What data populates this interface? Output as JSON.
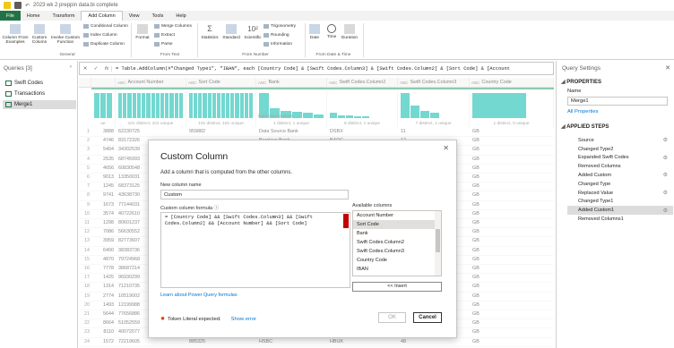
{
  "app": {
    "title": "2023 wk 2 preppin data.bi complete"
  },
  "tabs": [
    "File",
    "Home",
    "Transform",
    "Add Column",
    "View",
    "Tools",
    "Help"
  ],
  "ribbon": {
    "general": {
      "col_from_examples": "Column From Examples",
      "custom_column": "Custom Column",
      "invoke_custom_function": "Invoke Custom Function",
      "conditional_column": "Conditional Column",
      "index_column": "Index Column",
      "duplicate_column": "Duplicate Column",
      "group": "General"
    },
    "from_text": {
      "format": "Format",
      "merge_columns": "Merge Columns",
      "extract": "Extract",
      "parse": "Parse",
      "group": "From Text"
    },
    "from_number": {
      "statistics": "Statistics",
      "standard": "Standard",
      "scientific": "Scientific",
      "trigonometry": "Trigonometry",
      "rounding": "Rounding",
      "information": "Information",
      "group": "From Number"
    },
    "from_date_time": {
      "date": "Date",
      "time": "Time",
      "duration": "Duration",
      "group": "From Date & Time"
    }
  },
  "queries": {
    "header": "Queries [3]",
    "items": [
      "Swift Codes",
      "Transactions",
      "Merge1"
    ]
  },
  "formula": "= Table.AddColumn(#\"Changed Type1\", \"IBAN\", each [Country Code] & [Swift Codes.Column3] & [Swift Codes.Column2] & [Sort Code] & [Account",
  "grid": {
    "columns": [
      {
        "name": "",
        "type": ""
      },
      {
        "name": "Account Number",
        "type": "ABC"
      },
      {
        "name": "Sort Code",
        "type": "ABC"
      },
      {
        "name": "Bank",
        "type": "ABC"
      },
      {
        "name": "Swift Codes.Column2",
        "type": "ABC"
      },
      {
        "name": "Swift Codes.Column3",
        "type": "ABC"
      },
      {
        "name": "Country Code",
        "type": "ABC"
      }
    ],
    "profile": [
      "ue",
      "101 distinct, 101 unique",
      "101 distinct, 101 unique",
      "1 distinct, 1 unique",
      "8 distinct, 1 unique",
      "7 distinct, 1 unique",
      "1 distinct, 0 unique"
    ],
    "profile_label": "Data Source Bank",
    "rows": [
      [
        "1",
        "3888",
        "62230725",
        "959882",
        "Data Source Bank",
        "DSBX",
        "11",
        "GB"
      ],
      [
        "2",
        "4746",
        "83172326",
        "",
        "Barclays Bank",
        "BARC",
        "12",
        "GB"
      ],
      [
        "3",
        "5404",
        "34302539",
        "",
        "",
        "",
        "",
        "GB"
      ],
      [
        "4",
        "2535",
        "68745993",
        "",
        "",
        "",
        "",
        "GB"
      ],
      [
        "5",
        "4656",
        "60830548",
        "",
        "",
        "",
        "",
        "GB"
      ],
      [
        "6",
        "9013",
        "13350031",
        "",
        "",
        "",
        "",
        "GB"
      ],
      [
        "7",
        "1245",
        "68373125",
        "",
        "",
        "",
        "",
        "GB"
      ],
      [
        "8",
        "9741",
        "43638730",
        "",
        "",
        "",
        "",
        "GB"
      ],
      [
        "9",
        "1673",
        "77144031",
        "",
        "",
        "",
        "",
        "GB"
      ],
      [
        "10",
        "3574",
        "40722610",
        "",
        "",
        "",
        "",
        "GB"
      ],
      [
        "11",
        "1298",
        "80601237",
        "",
        "",
        "",
        "",
        "GB"
      ],
      [
        "12",
        "7086",
        "56630552",
        "",
        "",
        "",
        "",
        "GB"
      ],
      [
        "13",
        "3959",
        "82773607",
        "",
        "",
        "",
        "",
        "GB"
      ],
      [
        "14",
        "6400",
        "38383736",
        "",
        "",
        "",
        "",
        "GB"
      ],
      [
        "15",
        "4870",
        "79724968",
        "",
        "",
        "",
        "",
        "GB"
      ],
      [
        "16",
        "7778",
        "38687214",
        "",
        "",
        "",
        "",
        "GB"
      ],
      [
        "17",
        "1425",
        "96930299",
        "",
        "",
        "",
        "",
        "GB"
      ],
      [
        "18",
        "1314",
        "71210735",
        "",
        "",
        "",
        "",
        "GB"
      ],
      [
        "19",
        "2774",
        "10519002",
        "",
        "",
        "",
        "",
        "GB"
      ],
      [
        "20",
        "1493",
        "12199988",
        "",
        "",
        "",
        "",
        "GB"
      ],
      [
        "21",
        "5644",
        "77656886",
        "",
        "",
        "",
        "",
        "GB"
      ],
      [
        "22",
        "8664",
        "51052559",
        "",
        "",
        "",
        "",
        "GB"
      ],
      [
        "23",
        "8110",
        "40072077",
        "",
        "",
        "",
        "",
        "GB"
      ],
      [
        "24",
        "1572",
        "72219605",
        "885325",
        "HSBC",
        "HBUK",
        "48",
        "GB"
      ]
    ]
  },
  "dialog": {
    "title": "Custom Column",
    "description": "Add a column that is computed from the other columns.",
    "name_label": "New column name",
    "name_value": "Custom",
    "formula_label": "Custom column formula",
    "formula_value": "= [Country Code] && [Swift Codes.Column3] && [Swift Codes.Column2] && [Account Number] && [Sort Code]",
    "available_label": "Available columns",
    "available": [
      "Account Number",
      "Sort Code",
      "Bank",
      "Swift Codes.Column2",
      "Swift Codes.Column3",
      "Country Code",
      "IBAN"
    ],
    "insert": "<< Insert",
    "learn": "Learn about Power Query formulas",
    "status": "Token Literal expected.",
    "show_error": "Show error",
    "ok": "OK",
    "cancel": "Cancel"
  },
  "settings": {
    "header": "Query Settings",
    "properties": "PROPERTIES",
    "name_label": "Name",
    "name_value": "Merge1",
    "all_properties": "All Properties",
    "applied_steps": "APPLIED STEPS",
    "steps": [
      "Source",
      "Changed Type2",
      "Expanded Swift Codes",
      "Removed Columns",
      "Added Custom",
      "Changed Type",
      "Replaced Value",
      "Changed Type1",
      "Added Custom1",
      "Removed Columns1"
    ],
    "gear_steps": [
      0,
      2,
      4,
      6,
      8
    ]
  },
  "colors": {
    "accent": "#217346",
    "teal": "#01b8aa",
    "link": "#0078d4"
  }
}
